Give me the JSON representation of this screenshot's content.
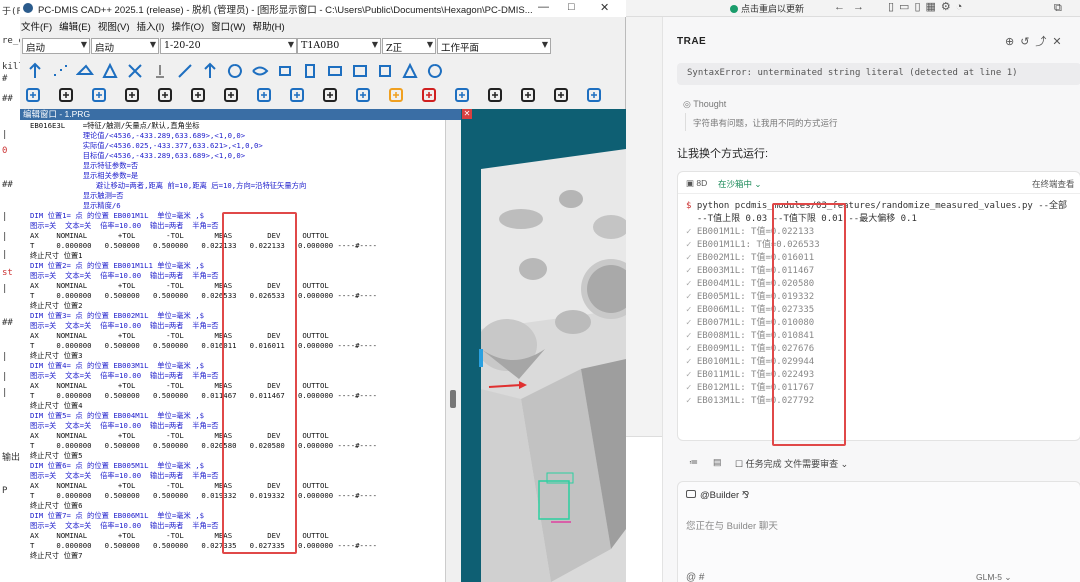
{
  "background_left_lines": [
    "于(F)",
    "re_c",
    "kills",
    "#",
    "##",
    "|",
    "0",
    "##",
    "|",
    "|",
    "|",
    "st",
    "|",
    "##",
    "|",
    "|",
    "|",
    "输出",
    "P"
  ],
  "pcdmis": {
    "title": "PC-DMIS CAD++ 2025.1 (release) - 脱机 (管理员) - [图形显示窗口 - C:\\Users\\Public\\Documents\\Hexagon\\PC-DMIS...",
    "window_controls": [
      "—",
      "□",
      "✕"
    ],
    "menu": [
      "文件(F)",
      "编辑(E)",
      "视图(V)",
      "插入(I)",
      "操作(O)",
      "窗口(W)",
      "帮助(H)"
    ],
    "combos": [
      "启动",
      "启动",
      "1-20-20",
      "T1A0B0",
      "Z正",
      "工作平面"
    ],
    "edit_title": "编辑窗口 - 1.PRG",
    "edit_lines": [
      "EB016E3L    =特征/触测/矢量点/默认,直角坐标",
      "            理论值/<4536,-433.289,633.689>,<1,0,0>",
      "            实际值/<4536.025,-433.377,633.621>,<1,0,0>",
      "            目标值/<4536,-433.289,633.689>,<1,0,0>",
      "            显示特征参数=否",
      "            显示相关参数=是",
      "               避让移动=两者,距离 前=10,距离 后=10,方向=沿特征矢量方向",
      "            显示触测=否",
      "            显示精度/6",
      "DIM 位置1= 点 的位置 EB001M1L  单位=毫米 ,$",
      "图示=关  文本=关  倍率=10.00  输出=两者  半角=否",
      "AX    NOMINAL       +TOL       -TOL       MEAS        DEV     OUTTOL",
      "T     0.000000   0.500000   0.500000   0.022133   0.022133   0.000000 ----#----",
      "终止尺寸 位置1",
      "DIM 位置2= 点 的位置 EB001M1L1 单位=毫米 ,$",
      "图示=关  文本=关  倍率=10.00  输出=两者  半角=否",
      "AX    NOMINAL       +TOL       -TOL       MEAS        DEV     OUTTOL",
      "T     0.000000   0.500000   0.500000   0.026533   0.026533   0.000000 ----#----",
      "终止尺寸 位置2",
      "DIM 位置3= 点 的位置 EB002M1L  单位=毫米 ,$",
      "图示=关  文本=关  倍率=10.00  输出=两者  半角=否",
      "AX    NOMINAL       +TOL       -TOL       MEAS        DEV     OUTTOL",
      "T     0.000000   0.500000   0.500000   0.016011   0.016011   0.000000 ----#----",
      "终止尺寸 位置3",
      "DIM 位置4= 点 的位置 EB003M1L  单位=毫米 ,$",
      "图示=关  文本=关  倍率=10.00  输出=两者  半角=否",
      "AX    NOMINAL       +TOL       -TOL       MEAS        DEV     OUTTOL",
      "T     0.000000   0.500000   0.500000   0.011467   0.011467   0.000000 ----#----",
      "终止尺寸 位置4",
      "DIM 位置5= 点 的位置 EB004M1L  单位=毫米 ,$",
      "图示=关  文本=关  倍率=10.00  输出=两者  半角=否",
      "AX    NOMINAL       +TOL       -TOL       MEAS        DEV     OUTTOL",
      "T     0.000000   0.500000   0.500000   0.020580   0.020580   0.000000 ----#----",
      "终止尺寸 位置5",
      "DIM 位置6= 点 的位置 EB005M1L  单位=毫米 ,$",
      "图示=关  文本=关  倍率=10.00  输出=两者  半角=否",
      "AX    NOMINAL       +TOL       -TOL       MEAS        DEV     OUTTOL",
      "T     0.000000   0.500000   0.500000   0.019332   0.019332   0.000000 ----#----",
      "终止尺寸 位置6",
      "DIM 位置7= 点 的位置 EB006M1L  单位=毫米 ,$",
      "图示=关  文本=关  倍率=10.00  输出=两者  半角=否",
      "AX    NOMINAL       +TOL       -TOL       MEAS        DEV     OUTTOL",
      "T     0.000000   0.500000   0.500000   0.027335   0.027335   0.000000 ----#----",
      "终止尺寸 位置7"
    ]
  },
  "trae": {
    "update_label": "点击重启以更新",
    "title": "TRAE",
    "error_text": "SyntaxError: unterminated string literal (detected at line 1)",
    "thought_label": "Thought",
    "thought_text": "字符串有问题，让我用不同的方式运行",
    "reply": "让我换个方式运行:",
    "terminal": {
      "tag": "8D",
      "running": "在沙箱中",
      "view_label": "在终端查看",
      "command_1": "python pcdmis_modules/03_features/randomize_measured_values.py --全部",
      "command_2": "--T值上限 0.03 --T值下限 0.01 --最大偏移 0.1",
      "results": [
        "EB001M1L: T值=0.022133",
        "EB001M1L1: T值=0.026533",
        "EB002M1L: T值=0.016011",
        "EB003M1L: T值=0.011467",
        "EB004M1L: T值=0.020580",
        "EB005M1L: T值=0.019332",
        "EB006M1L: T值=0.027335",
        "EB007M1L: T值=0.010080",
        "EB008M1L: T值=0.010841",
        "EB009M1L: T值=0.027676",
        "EB010M1L: T值=0.029944",
        "EB011M1L: T值=0.022493",
        "EB012M1L: T值=0.011767",
        "EB013M1L: T值=0.027792"
      ]
    },
    "task_status": "任务完成 文件需要审查",
    "builder_label": "@Builder",
    "input_placeholder": "您正在与 Builder 聊天",
    "input_footer": "@  #",
    "model": "GLM-5"
  },
  "colors": {
    "highlight_box": "#e04848",
    "edit_title": "#3a6ea5",
    "viewport_bg": "#0e5f73"
  }
}
